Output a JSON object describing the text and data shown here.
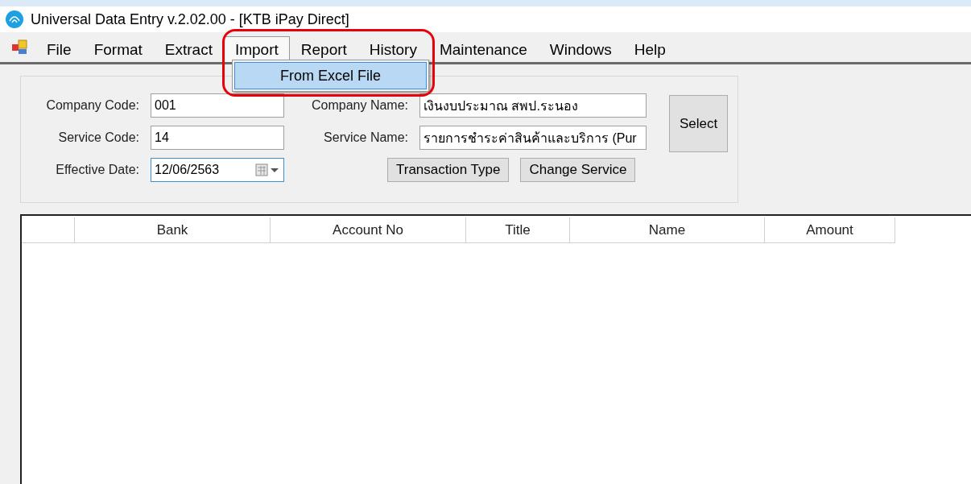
{
  "window": {
    "title": "Universal Data Entry v.2.02.00 - [KTB iPay Direct]"
  },
  "menu": [
    {
      "label": "File",
      "selected": false
    },
    {
      "label": "Format",
      "selected": false
    },
    {
      "label": "Extract",
      "selected": false
    },
    {
      "label": "Import",
      "selected": true
    },
    {
      "label": "Report",
      "selected": false
    },
    {
      "label": "History",
      "selected": false
    },
    {
      "label": "Maintenance",
      "selected": false
    },
    {
      "label": "Windows",
      "selected": false
    },
    {
      "label": "Help",
      "selected": false
    }
  ],
  "dropdown": {
    "items": [
      {
        "label": "From Excel File",
        "selected": true
      }
    ]
  },
  "form": {
    "company_code": {
      "label": "Company Code:",
      "value": "001"
    },
    "company_name": {
      "label": "Company Name:",
      "value": "เงินงบประมาณ สพป.ระนอง"
    },
    "service_code": {
      "label": "Service Code:",
      "value": "14"
    },
    "service_name": {
      "label": "Service Name:",
      "value": "รายการชำระค่าสินค้าและบริการ (Pur"
    },
    "effective_date": {
      "label": "Effective Date:",
      "value": "12/06/2563"
    },
    "buttons": [
      "Transaction Type",
      "Change Service"
    ],
    "select_button": "Select"
  },
  "table": {
    "columns": [
      "Bank",
      "Account No",
      "Title",
      "Name",
      "Amount"
    ]
  },
  "annotation": {
    "kind": "highlight"
  }
}
